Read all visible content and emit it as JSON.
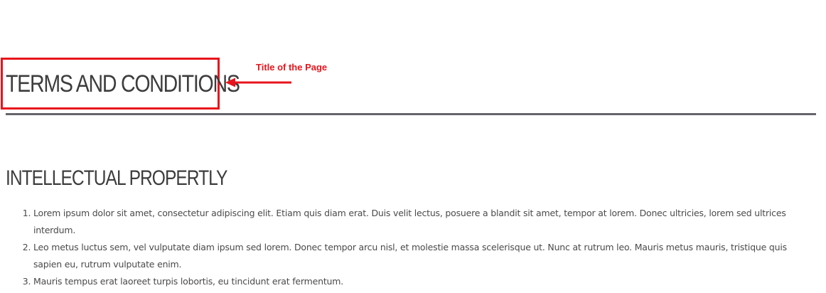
{
  "page": {
    "title": "TERMS AND CONDITIONS"
  },
  "annotation": {
    "label": "Title of the Page",
    "color": "#e8141c"
  },
  "section": {
    "heading": "INTELLECTUAL PROPERTLY",
    "items": [
      "Lorem ipsum dolor sit amet, consectetur adipiscing elit. Etiam quis diam erat. Duis velit lectus, posuere a blandit sit amet, tempor at lorem. Donec ultricies, lorem sed ultrices interdum.",
      "Leo metus luctus sem, vel vulputate diam ipsum sed lorem. Donec tempor arcu nisl, et molestie massa scelerisque ut. Nunc at rutrum leo. Mauris metus mauris, tristique quis sapien eu, rutrum vulputate enim.",
      "Mauris tempus erat laoreet turpis lobortis, eu tincidunt erat fermentum."
    ]
  },
  "colors": {
    "divider": "#66646b",
    "text": "#3d3d3d"
  }
}
